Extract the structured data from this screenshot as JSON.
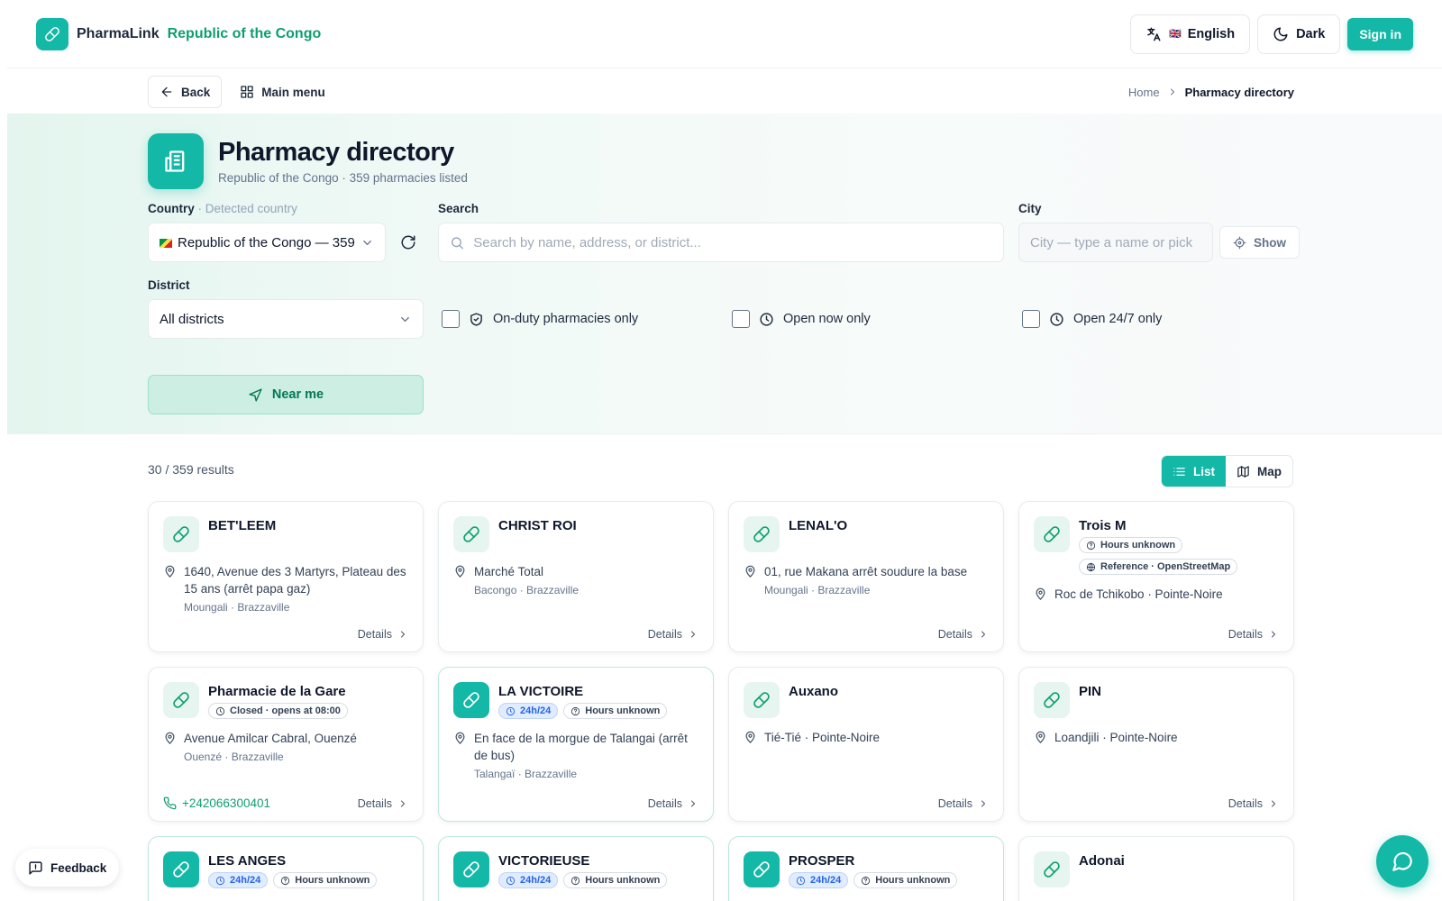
{
  "app": {
    "brand": "PharmaLink",
    "country": "Republic of the Congo"
  },
  "topbar": {
    "language": "English",
    "language_flag": "🇬🇧",
    "theme": "Dark",
    "signin": "Sign in"
  },
  "nav": {
    "back": "Back",
    "main_menu": "Main menu",
    "breadcrumb": [
      "Home",
      "Pharmacy directory"
    ]
  },
  "page": {
    "title": "Pharmacy directory",
    "subtitle": "Republic of the Congo · 359 pharmacies listed"
  },
  "filters": {
    "country_label": "Country",
    "country_hint": "· Detected country",
    "country_value": "Republic of the Congo — 359",
    "search_label": "Search",
    "search_placeholder": "Search by name, address, or district...",
    "city_label": "City",
    "city_placeholder": "City — type a name or pick",
    "show": "Show",
    "district_label": "District",
    "district_value": "All districts",
    "on_duty": "On-duty pharmacies only",
    "open_now": "Open now only",
    "open_247": "Open 24/7 only",
    "near_me": "Near me"
  },
  "results": {
    "count": "30 / 359 results",
    "view_list": "List",
    "view_map": "Map"
  },
  "details_label": "Details",
  "cards": [
    {
      "name": "BET'LEEM",
      "badges": [],
      "address": "1640, Avenue des 3 Martyrs, Plateau des 15 ans (arrêt papa gaz)",
      "locality": "Moungali · Brazzaville",
      "phone": "",
      "solid": false,
      "onduty": false
    },
    {
      "name": "CHRIST ROI",
      "badges": [],
      "address": "Marché Total",
      "locality": "Bacongo · Brazzaville",
      "phone": "",
      "solid": false,
      "onduty": false
    },
    {
      "name": "LENAL'O",
      "badges": [],
      "address": "01, rue Makana arrêt soudure la base",
      "locality": "Moungali · Brazzaville",
      "phone": "",
      "solid": false,
      "onduty": false
    },
    {
      "name": "Trois M",
      "badges": [
        {
          "text": "Hours unknown",
          "icon": "help-circle-icon",
          "blue": false
        },
        {
          "text": "Reference · OpenStreetMap",
          "icon": "globe-icon",
          "blue": false
        }
      ],
      "address": "Roc de Tchikobo · Pointe-Noire",
      "locality": "",
      "phone": "",
      "solid": false,
      "onduty": false
    },
    {
      "name": "Pharmacie de la Gare",
      "badges": [
        {
          "text": "Closed · opens at 08:00",
          "icon": "clock-icon",
          "blue": false
        }
      ],
      "address": "Avenue Amilcar Cabral, Ouenzé",
      "locality": "Ouenzé · Brazzaville",
      "phone": "+242066300401",
      "solid": false,
      "onduty": false
    },
    {
      "name": "LA VICTOIRE",
      "badges": [
        {
          "text": "24h/24",
          "icon": "clock-icon",
          "blue": true
        },
        {
          "text": "Hours unknown",
          "icon": "help-circle-icon",
          "blue": false
        }
      ],
      "address": "En face de la morgue de Talangai (arrêt de bus)",
      "locality": "Talangaï · Brazzaville",
      "phone": "",
      "solid": true,
      "onduty": true
    },
    {
      "name": "Auxano",
      "badges": [],
      "address": "Tié-Tié · Pointe-Noire",
      "locality": "",
      "phone": "",
      "solid": false,
      "onduty": false
    },
    {
      "name": "PIN",
      "badges": [],
      "address": "Loandjili · Pointe-Noire",
      "locality": "",
      "phone": "",
      "solid": false,
      "onduty": false
    },
    {
      "name": "LES ANGES",
      "badges": [
        {
          "text": "24h/24",
          "icon": "clock-icon",
          "blue": true
        },
        {
          "text": "Hours unknown",
          "icon": "help-circle-icon",
          "blue": false
        }
      ],
      "address": "",
      "locality": "",
      "phone": "",
      "solid": true,
      "onduty": true
    },
    {
      "name": "VICTORIEUSE",
      "badges": [
        {
          "text": "24h/24",
          "icon": "clock-icon",
          "blue": true
        },
        {
          "text": "Hours unknown",
          "icon": "help-circle-icon",
          "blue": false
        }
      ],
      "address": "",
      "locality": "",
      "phone": "",
      "solid": true,
      "onduty": true
    },
    {
      "name": "PROSPER",
      "badges": [
        {
          "text": "24h/24",
          "icon": "clock-icon",
          "blue": true
        },
        {
          "text": "Hours unknown",
          "icon": "help-circle-icon",
          "blue": false
        }
      ],
      "address": "",
      "locality": "",
      "phone": "",
      "solid": true,
      "onduty": true
    },
    {
      "name": "Adonai",
      "badges": [],
      "address": "",
      "locality": "",
      "phone": "",
      "solid": false,
      "onduty": false
    }
  ],
  "feedback": "Feedback",
  "colors": {
    "accent": "#14b8a6",
    "accent_dark": "#0e9f6e",
    "badge_blue": "#2563eb"
  }
}
